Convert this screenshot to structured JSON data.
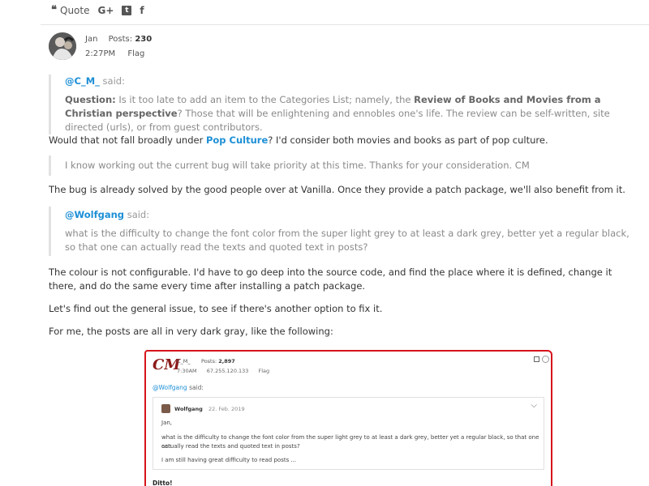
{
  "share": {
    "quote_label": "Quote",
    "gplus_label": "G+",
    "twitter_label": "t",
    "facebook_label": "f"
  },
  "post": {
    "author": "Jan",
    "posts_label": "Posts:",
    "posts_count": "230",
    "time": "2:27PM",
    "flag_label": "Flag"
  },
  "quote1": {
    "mention": "@C_M_",
    "said": "said:",
    "question_label": "Question:",
    "text_a": "Is it too late to add an item to the Categories List; namely, the",
    "bold_text": "Review of Books and Movies from a Christian perspective",
    "text_b": "? Those that will be enlightening and ennobles one's life. The review can be self-written, site directed (urls), or from guest contributors."
  },
  "para1": {
    "text_a": "Would that not fall broadly under",
    "link": "Pop Culture",
    "text_b": "? I'd consider both movies and books as part of pop culture."
  },
  "quote2": {
    "text": "I know working out the current bug will take priority at this time. Thanks for your consideration. CM"
  },
  "para2": {
    "text": "The bug is already solved by the good people over at Vanilla. Once they provide a patch package, we'll also benefit from it."
  },
  "quote3": {
    "mention": "@Wolfgang",
    "said": "said:",
    "text": "what is the difficulty to change the font color from the super light grey to at least a dark grey, better yet a regular black, so that one can actually read the texts and quoted text in posts?"
  },
  "para3": {
    "text": "The colour is not configurable. I'd have to go deep into the source code, and find the place where it is defined, change it there, and do the same every time after installing a patch package."
  },
  "para4": {
    "text": "Let's find out the general issue, to see if there's another option to fix it."
  },
  "para5": {
    "text": "For me, the posts are all in very dark gray, like the following:"
  },
  "screenshot": {
    "logo": "CM",
    "name": "C_M_",
    "posts_label": "Posts:",
    "posts_count": "2,897",
    "time": "7:30AM",
    "ip": "67.255.120.133",
    "flag": "Flag",
    "mention": "@Wolfgang",
    "said": "said:",
    "quote_author": "Wolfgang",
    "quote_date": "22. Feb. 2019",
    "quote_greeting": "Jan,",
    "quote_line1": "what is the difficulty to change the font color from the super light grey to at least a dark grey, better yet a regular black, so that one can",
    "quote_line2": "actually read the texts and quoted text in posts?",
    "quote_line3": "I am still having great difficulty to read posts ...",
    "ditto": "Ditto!"
  }
}
